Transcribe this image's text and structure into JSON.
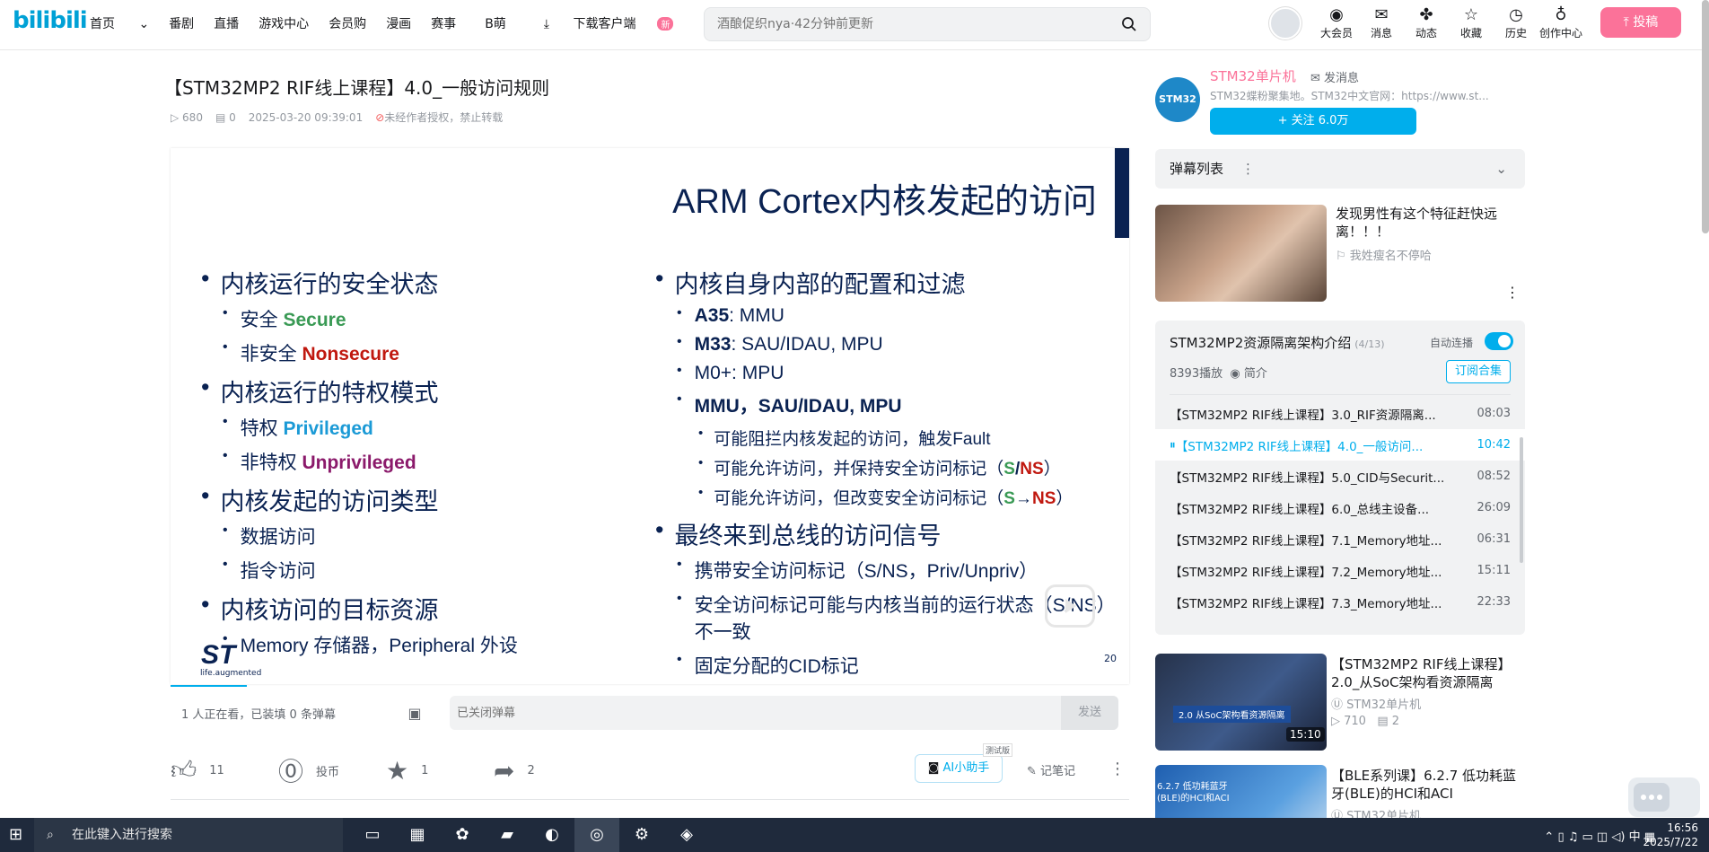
{
  "header": {
    "logo": "bilibili",
    "nav": [
      "首页",
      "番剧",
      "直播",
      "游戏中心",
      "会员购",
      "漫画",
      "赛事",
      "B萌",
      "下载客户端"
    ],
    "nav_badge": "新",
    "search_placeholder": "酒酿促织nya·42分钟前更新",
    "right": [
      {
        "icon": "vip-icon",
        "label": "大会员",
        "glyph": "◉"
      },
      {
        "icon": "message-icon",
        "label": "消息",
        "glyph": "✉"
      },
      {
        "icon": "dynamic-icon",
        "label": "动态",
        "glyph": "✤"
      },
      {
        "icon": "favorite-icon",
        "label": "收藏",
        "glyph": "☆"
      },
      {
        "icon": "history-icon",
        "label": "历史",
        "glyph": "◷"
      },
      {
        "icon": "creator-icon",
        "label": "创作中心",
        "glyph": "♁"
      }
    ],
    "upload_label": "投稿"
  },
  "video": {
    "title": "【STM32MP2 RIF线上课程】4.0_一般访问规则",
    "views": "680",
    "danmaku_count": "0",
    "date": "2025-03-20 09:39:01",
    "rights": "未经作者授权，禁止转载"
  },
  "slide": {
    "title": "ARM Cortex内核发起的访问",
    "left": [
      {
        "lv": 1,
        "text": "内核运行的安全状态"
      },
      {
        "lv": 2,
        "text": "安全 ",
        "em": "Secure",
        "cls": "g"
      },
      {
        "lv": 2,
        "text": "非安全 ",
        "em": "Nonsecure",
        "cls": "r"
      },
      {
        "lv": 1,
        "text": "内核运行的特权模式"
      },
      {
        "lv": 2,
        "text": "特权 ",
        "em": "Privileged",
        "cls": "b"
      },
      {
        "lv": 2,
        "text": "非特权 ",
        "em": "Unprivileged",
        "cls": "p"
      },
      {
        "lv": 1,
        "text": "内核发起的访问类型"
      },
      {
        "lv": 2,
        "text": "数据访问"
      },
      {
        "lv": 2,
        "text": "指令访问"
      },
      {
        "lv": 1,
        "text": "内核访问的目标资源"
      },
      {
        "lv": 2,
        "text": "Memory 存储器，Peripheral 外设"
      }
    ],
    "right": [
      {
        "lv": 1,
        "text": "内核自身内部的配置和过滤"
      },
      {
        "lv": 2,
        "bold": "A35",
        "text": ": MMU"
      },
      {
        "lv": 2,
        "bold": "M33",
        "text": ": SAU/IDAU, MPU"
      },
      {
        "lv": 2,
        "text": "M0+: MPU"
      },
      {
        "lv": 2,
        "bold": "MMU，SAU/IDAU, MPU",
        "text": ""
      },
      {
        "lv": 3,
        "text": "可能阻拦内核发起的访问，触发Fault"
      },
      {
        "lv": 3,
        "text": "可能允许访问，并保持安全访问标记（",
        "g": "S",
        "sep": "/",
        "r": "NS",
        "tail": "）"
      },
      {
        "lv": 3,
        "text": "可能允许访问，但改变安全访问标记（",
        "g": "S",
        "sep": "→",
        "r": "NS",
        "tail": "）"
      },
      {
        "lv": 1,
        "text": "最终来到总线的访问信号"
      },
      {
        "lv": 2,
        "text": "携带安全访问标记（S/NS，Priv/Unpriv）"
      },
      {
        "lv": 2,
        "text": "安全访问标记可能与内核当前的运行状态（S/NS）不一致"
      },
      {
        "lv": 2,
        "text": "固定分配的CID标记"
      }
    ],
    "logo": "ST",
    "tagline": "life.augmented",
    "page": "20"
  },
  "player": {
    "viewers": "1 人正在看，已装填 0 条弹幕",
    "danmaku_placeholder": "已关闭弹幕",
    "send": "发送",
    "progress": 0.08
  },
  "actions": {
    "like": "11",
    "coin": "投币",
    "fav": "1",
    "share": "2",
    "ai": "AI小助手",
    "ai_tag": "测试版",
    "notes": "记笔记"
  },
  "uploader": {
    "avatar": "STM32",
    "name": "STM32单片机",
    "msg": "发消息",
    "desc": "STM32蝶粉聚集地。STM32中文官网：https://www.st...",
    "follow": "+ 关注 6.0万"
  },
  "danmaku_list": "弹幕列表",
  "ad": {
    "title": "发现男性有这个特征赶快远离！！！",
    "author": "我姓瘦名不停哈"
  },
  "collection": {
    "title": "STM32MP2资源隔离架构介绍",
    "count": "(4/13)",
    "autoplay": "自动连播",
    "plays": "8393播放",
    "intro": "简介",
    "subscribe": "订阅合集",
    "items": [
      {
        "name": "【STM32MP2 RIF线上课程】3.0_RIF资源隔离...",
        "dur": "08:03",
        "active": false
      },
      {
        "name": "【STM32MP2 RIF线上课程】4.0_一般访问...",
        "dur": "10:42",
        "active": true
      },
      {
        "name": "【STM32MP2 RIF线上课程】5.0_CID与Securit...",
        "dur": "08:52",
        "active": false
      },
      {
        "name": "【STM32MP2 RIF线上课程】6.0_总线主设备...",
        "dur": "26:09",
        "active": false
      },
      {
        "name": "【STM32MP2 RIF线上课程】7.1_Memory地址...",
        "dur": "06:31",
        "active": false
      },
      {
        "name": "【STM32MP2 RIF线上课程】7.2_Memory地址...",
        "dur": "15:11",
        "active": false
      },
      {
        "name": "【STM32MP2 RIF线上课程】7.3_Memory地址...",
        "dur": "22:33",
        "active": false
      }
    ]
  },
  "recommend": [
    {
      "title": "【STM32MP2 RIF线上课程】2.0_从SoC架构看资源隔离",
      "author": "STM32单片机",
      "views": "710",
      "dm": "2",
      "dur": "15:10",
      "thumb_text": "2.0 从SoC架构看资源隔离"
    },
    {
      "title": "【BLE系列课】6.2.7 低功耗蓝牙(BLE)的HCI和ACI",
      "author": "STM32单片机",
      "views": "",
      "dm": "",
      "dur": "",
      "thumb_text": "6.2.7 低功耗蓝牙(BLE)的HCI和ACI"
    }
  ],
  "taskbar": {
    "search": "在此键入进行搜索",
    "ime": "中",
    "time": "16:56",
    "date": "2025/7/22"
  }
}
